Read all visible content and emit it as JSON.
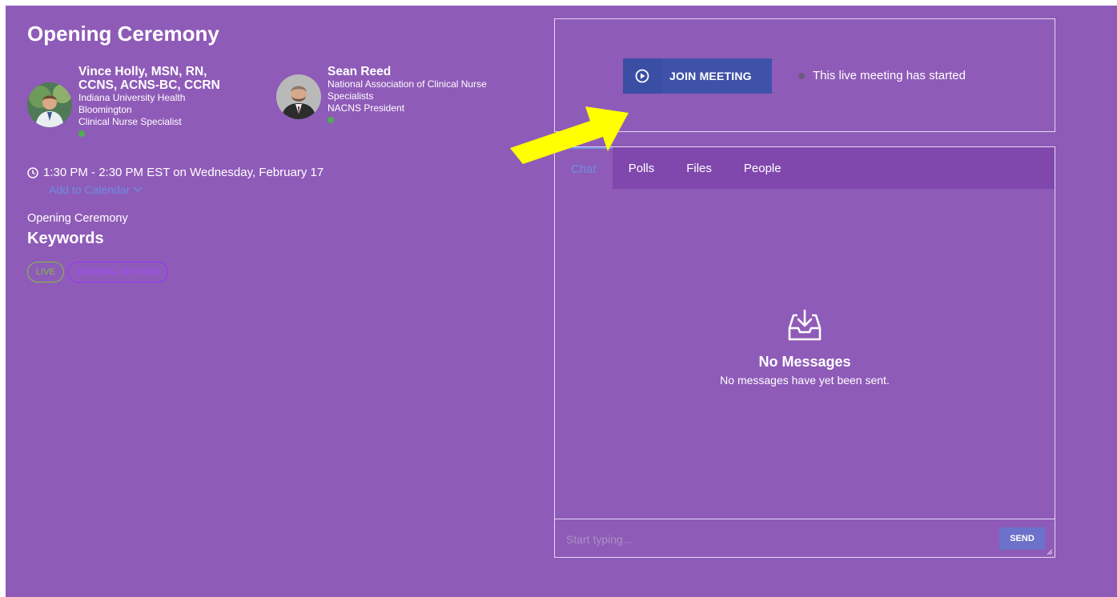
{
  "session": {
    "title": "Opening Ceremony",
    "time": "1:30 PM - 2:30 PM EST on Wednesday, February 17",
    "add_to_calendar": "Add to Calendar",
    "description": "Opening Ceremony",
    "keywords_title": "Keywords",
    "tags": [
      "LIVE",
      "GENERAL SESSION"
    ]
  },
  "speakers": [
    {
      "name": "Vince Holly, MSN, RN, CCNS, ACNS-BC, CCRN",
      "lines": [
        "Indiana University Health",
        "Bloomington",
        "Clinical Nurse Specialist"
      ]
    },
    {
      "name": "Sean Reed",
      "lines": [
        "National Association of Clinical Nurse",
        "Specialists",
        "NACNS President"
      ]
    }
  ],
  "meeting": {
    "join_label": "JOIN MEETING",
    "status_text": "This live meeting has started"
  },
  "chat": {
    "tabs": [
      "Chat",
      "Polls",
      "Files",
      "People"
    ],
    "empty_title": "No Messages",
    "empty_text": "No messages have yet been sent.",
    "input_placeholder": "Start typing...",
    "send_label": "SEND"
  },
  "colors": {
    "background": "#8f5bb8",
    "tab_bar": "#8048ad",
    "join_button": "#3f52a9",
    "link": "#6d8ee0",
    "live_tag": "#7ec13e",
    "general_tag": "#9b30ff",
    "online_dot": "#4caf50",
    "arrow": "#ffff00"
  },
  "icons": {
    "clock": "clock-icon",
    "chevron": "chevron-down-icon",
    "play": "play-circle-icon",
    "inbox": "inbox-download-icon",
    "arrow": "pointer-arrow-icon"
  }
}
